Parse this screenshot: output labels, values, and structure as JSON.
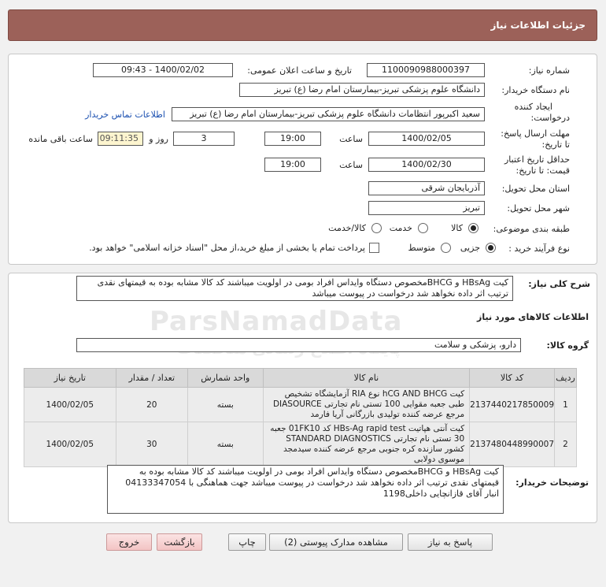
{
  "header": {
    "title": "جزئیات اطلاعات نیاز"
  },
  "form": {
    "need_number_label": "شماره نیاز:",
    "need_number": "1100090988000397",
    "announce_label": "تاریخ و ساعت اعلان عمومی:",
    "announce_value": "1400/02/02 - 09:43",
    "buyer_label": "نام دستگاه خریدار:",
    "buyer_value": "دانشگاه علوم پزشکی تبریز-بیمارستان امام رضا (ع) تبریز",
    "creator_label_1": "ایجاد کننده",
    "creator_label_2": "درخواست:",
    "creator_value": "سعید اکبرپور انتظامات دانشگاه علوم پزشکی تبریز-بیمارستان امام رضا (ع) تبریز",
    "buyer_contact_link": "اطلاعات تماس خریدار",
    "deadline_label_1": "مهلت ارسال پاسخ:",
    "deadline_label_2": "تا تاریخ:",
    "deadline_date": "1400/02/05",
    "time_label": "ساعت",
    "deadline_time": "19:00",
    "days_value": "3",
    "days_label": "روز و",
    "remaining_time": "09:11:35",
    "remaining_label": "ساعت باقی مانده",
    "validity_label_1": "حداقل تاریخ اعتبار",
    "validity_label_2": "قیمت: تا تاریخ:",
    "validity_date": "1400/02/30",
    "validity_time_label": "ساعت",
    "validity_time": "19:00",
    "province_label": "استان محل تحویل:",
    "province_value": "آذربایجان شرقی",
    "city_label": "شهر محل تحویل:",
    "city_value": "تبریز",
    "category_label": "طبقه بندی موضوعی:",
    "category_options": [
      "کالا",
      "خدمت",
      "کالا/خدمت"
    ],
    "purchase_type_label": "نوع فرآیند خرید :",
    "purchase_options": [
      "جزیی",
      "متوسط"
    ],
    "payment_note": "پرداخت تمام یا بخشی از مبلغ خرید،از محل \"اسناد خزانه اسلامی\" خواهد بود."
  },
  "summary": {
    "label": "شرح کلی نیاز:",
    "text": "کیت HBsAg و BHCGمخصوص دستگاه وایداس افراد بومی در اولویت میباشند کد کالا مشابه بوده به قیمتهای نقدی ترتیب اثر داده نخواهد شد درخواست در پیوست میباشد"
  },
  "goods_info_title": "اطلاعات کالاهای مورد نیاز",
  "goods_group": {
    "label": "گروه کالا:",
    "value": "دارو، پزشکی و سلامت"
  },
  "table": {
    "headers": [
      "ردیف",
      "کد کالا",
      "نام کالا",
      "واحد شمارش",
      "تعداد / مقدار",
      "تاریخ نیاز"
    ],
    "rows": [
      {
        "index": "1",
        "code": "2137440217850009",
        "name": "کیت hCG AND BHCG نوع RIA آزمایشگاه تشخیص طبی جعبه مقوایی 100 تستی نام تجارتی DIASOURCE مرجع عرضه کننده تولیدی بازرگانی آریا فارمد",
        "unit": "بسته",
        "qty": "20",
        "date": "1400/02/05"
      },
      {
        "index": "2",
        "code": "2137480448990007",
        "name": "کیت آنتی هپاتیت HBs-Ag rapid test کد 01FK10 جعبه 30 تستی نام تجارتی STANDARD DIAGNOSTICS کشور سازنده کره جنوبی مرجع عرضه کننده سیدمجد موسوی دولابی",
        "unit": "بسته",
        "qty": "30",
        "date": "1400/02/05"
      }
    ]
  },
  "buyer_notes": {
    "label": "توضیحات خریدار:",
    "text": "کیت HBsAg و BHCGمخصوص دستگاه وایداس افراد بومی در اولویت میباشند کد کالا مشابه بوده به قیمتهای نقدی ترتیب اثر داده نخواهد شد درخواست در پیوست میباشد جهت هماهنگی با 04133347054 انبار آقای قازانچایی داخلی1198"
  },
  "buttons": {
    "reply": "پاسخ به نیاز",
    "attachments": "مشاهده مدارک پیوستی (2)",
    "print": "چاپ",
    "back": "بازگشت",
    "exit": "خروج"
  },
  "watermark": {
    "text": "ParsNamadData",
    "subtext": "پایگاه اطلاع رسانی مناقصات"
  }
}
